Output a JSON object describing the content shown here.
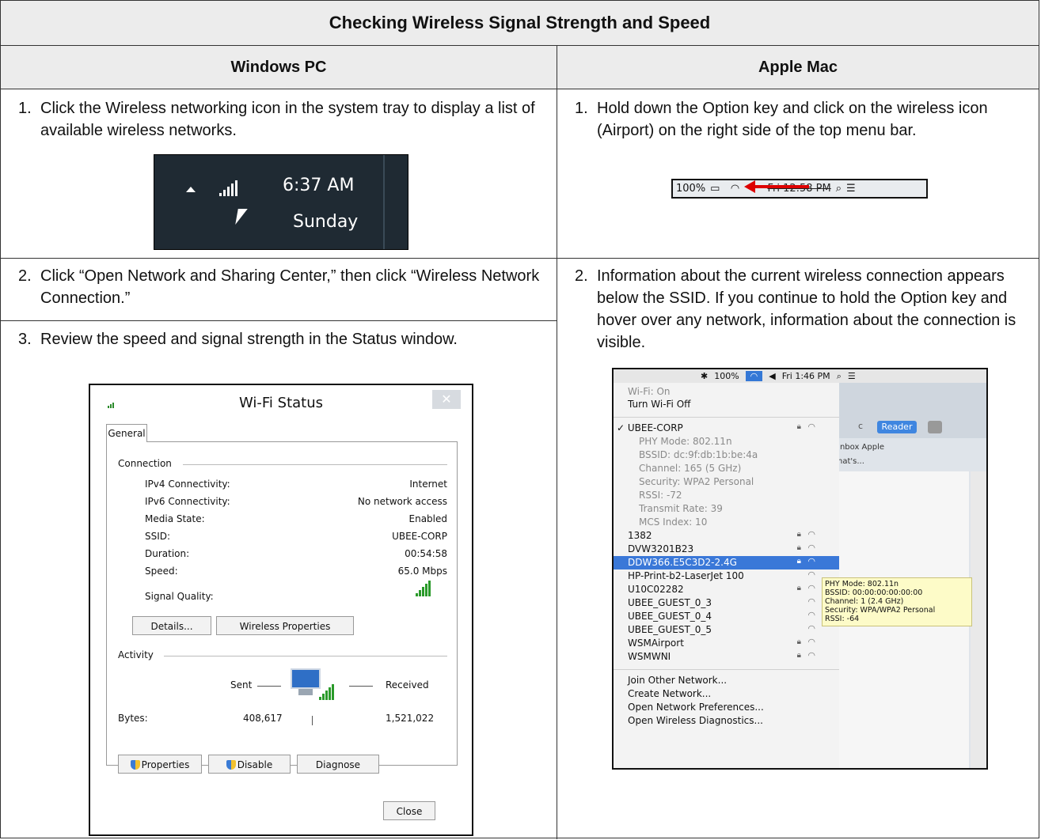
{
  "title": "Checking Wireless Signal Strength and Speed",
  "columns": {
    "left": "Windows PC",
    "right": "Apple Mac"
  },
  "windows": {
    "step1_num": "1.",
    "step1": "Click the Wireless networking icon in the system tray to display a list of available wireless networks.",
    "tray": {
      "time": "6:37 AM",
      "day": "Sunday"
    },
    "step2_num": "2.",
    "step2": "Click “Open Network and Sharing Center,” then click “Wireless Network Connection.”",
    "step3_num": "3.",
    "step3": "Review the speed and signal strength in the Status window.",
    "dialog": {
      "title": "Wi-Fi Status",
      "close_x": "✕",
      "tab": "General",
      "connection_label": "Connection",
      "rows": [
        {
          "label": "IPv4 Connectivity:",
          "value": "Internet"
        },
        {
          "label": "IPv6 Connectivity:",
          "value": "No network access"
        },
        {
          "label": "Media State:",
          "value": "Enabled"
        },
        {
          "label": "SSID:",
          "value": "UBEE-CORP"
        },
        {
          "label": "Duration:",
          "value": "00:54:58"
        },
        {
          "label": "Speed:",
          "value": "65.0 Mbps"
        }
      ],
      "signal_label": "Signal Quality:",
      "details_btn": "Details...",
      "wireless_props_btn": "Wireless Properties",
      "activity_label": "Activity",
      "sent_label": "Sent",
      "received_label": "Received",
      "bytes_label": "Bytes:",
      "bytes_sent": "408,617",
      "bytes_received": "1,521,022",
      "properties_btn": "Properties",
      "disable_btn": "Disable",
      "diagnose_btn": "Diagnose",
      "close_btn": "Close"
    }
  },
  "mac": {
    "step1_num": "1.",
    "step1": "Hold down the Option key and click on the wireless icon (Airport) on the right side of the top menu bar.",
    "menubar": {
      "battery": "100%",
      "time": "Fri 12:58 PM"
    },
    "step2_num": "2.",
    "step2": "Information about the current wireless connection appears below the SSID. If you continue to hold the Option key and hover over any network, information about the connection is visible.",
    "shot": {
      "topbar_battery": "100%",
      "topbar_time": "Fri 1:46 PM",
      "reader": "Reader",
      "browser_c": "c",
      "browser_tabs": "Inbox   Apple",
      "browser_tabs2": "hat's...",
      "wifi_on": "Wi-Fi: On",
      "turn_off": "Turn Wi-Fi Off",
      "current": "✓ UBEE-CORP",
      "details": [
        "PHY Mode: 802.11n",
        "BSSID: dc:9f:db:1b:be:4a",
        "Channel: 165 (5 GHz)",
        "Security: WPA2 Personal",
        "RSSI: -72",
        "Transmit Rate: 39",
        "MCS Index: 10"
      ],
      "networks": [
        "1382",
        "DVW3201B23",
        "DDW366.E5C3D2-2.4G",
        "HP-Print-b2-LaserJet 100",
        "U10C02282",
        "UBEE_GUEST_0_3",
        "UBEE_GUEST_0_4",
        "UBEE_GUEST_0_5",
        "WSMAirport",
        "WSMWNI"
      ],
      "actions": [
        "Join Other Network...",
        "Create Network...",
        "Open Network Preferences...",
        "Open Wireless Diagnostics..."
      ],
      "tooltip": [
        "PHY Mode: 802.11n",
        "BSSID: 00:00:00:00:00:00",
        "Channel: 1 (2.4 GHz)",
        "Security: WPA/WPA2 Personal",
        "RSSI: -64"
      ]
    }
  }
}
